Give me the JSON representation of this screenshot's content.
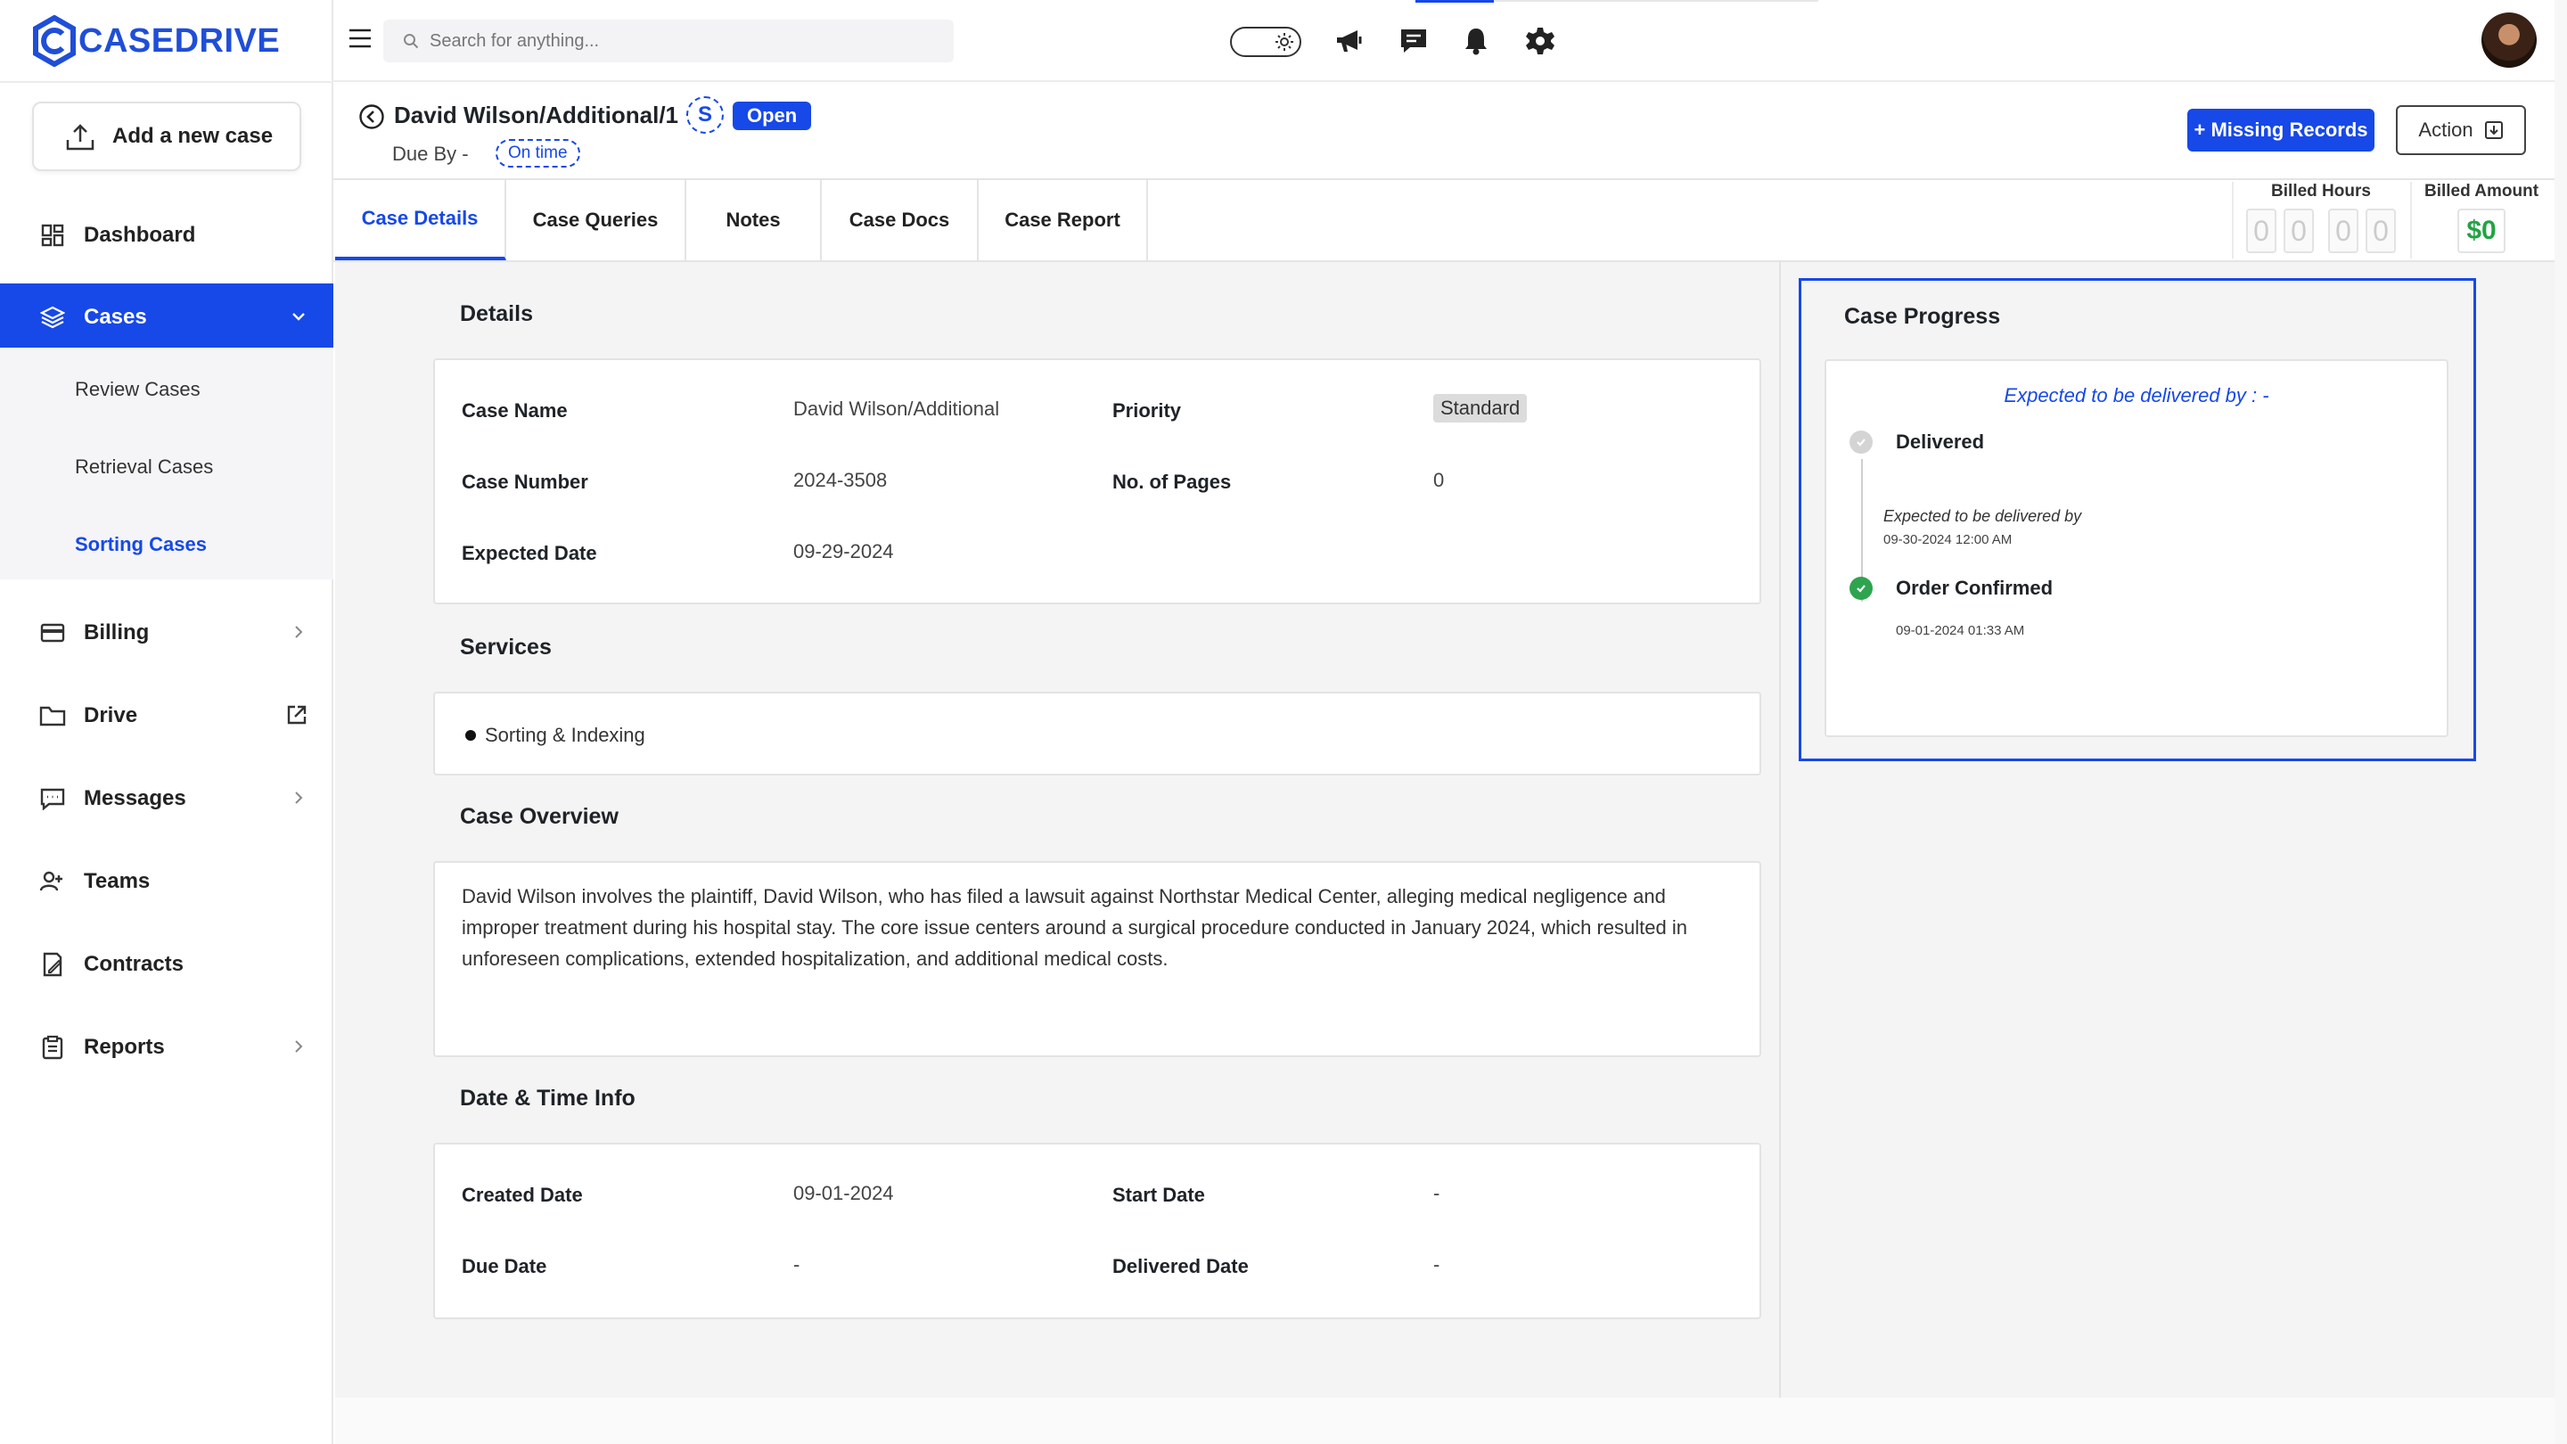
{
  "app": {
    "brand": "CASEDRIVE",
    "accent_color": "#1748e8"
  },
  "sidebar": {
    "add_case_label": "Add a new case",
    "items": [
      {
        "label": "Dashboard",
        "icon": "dashboard-icon"
      },
      {
        "label": "Cases",
        "icon": "layers-icon",
        "active": true,
        "expanded": true
      },
      {
        "label": "Billing",
        "icon": "credit-card-icon"
      },
      {
        "label": "Drive",
        "icon": "folder-icon"
      },
      {
        "label": "Messages",
        "icon": "message-icon"
      },
      {
        "label": "Teams",
        "icon": "users-icon"
      },
      {
        "label": "Contracts",
        "icon": "contract-icon"
      },
      {
        "label": "Reports",
        "icon": "clipboard-icon"
      }
    ],
    "sub_items": [
      {
        "label": "Review Cases"
      },
      {
        "label": "Retrieval Cases"
      },
      {
        "label": "Sorting Cases",
        "active": true
      }
    ]
  },
  "search": {
    "placeholder": "Search for anything..."
  },
  "case": {
    "title": "David Wilson/Additional/1",
    "assignee_initial": "S",
    "status": "Open",
    "due_by_label": "Due By -",
    "timeliness": "On time",
    "missing_records_label": "+ Missing Records",
    "action_label": "Action"
  },
  "tabs": [
    {
      "label": "Case Details",
      "active": true
    },
    {
      "label": "Case Queries"
    },
    {
      "label": "Notes"
    },
    {
      "label": "Case Docs"
    },
    {
      "label": "Case Report"
    }
  ],
  "billing": {
    "hours_label": "Billed Hours",
    "hours_digits": [
      "0",
      "0",
      "0",
      "0"
    ],
    "amount_label": "Billed Amount",
    "amount": "$0"
  },
  "details": {
    "title": "Details",
    "case_name_label": "Case Name",
    "case_name": "David  Wilson/Additional",
    "priority_label": "Priority",
    "priority": "Standard",
    "case_number_label": "Case Number",
    "case_number": "2024-3508",
    "pages_label": "No. of Pages",
    "pages": "0",
    "expected_date_label": "Expected Date",
    "expected_date": "09-29-2024"
  },
  "services": {
    "title": "Services",
    "items": [
      "Sorting & Indexing"
    ]
  },
  "overview": {
    "title": "Case Overview",
    "text": "David Wilson involves the plaintiff, David Wilson, who has filed a lawsuit against Northstar Medical Center, alleging medical negligence and improper treatment during his hospital stay. The core issue centers around a surgical procedure conducted in January 2024, which resulted in unforeseen complications, extended hospitalization, and additional medical costs."
  },
  "datetime": {
    "title": "Date & Time Info",
    "created_label": "Created Date",
    "created": "09-01-2024",
    "start_label": "Start Date",
    "start": "-",
    "due_label": "Due Date",
    "due": "-",
    "delivered_label": "Delivered Date",
    "delivered": "-"
  },
  "progress": {
    "title": "Case Progress",
    "expected_header": "Expected to be delivered by : -",
    "steps": [
      {
        "label": "Delivered",
        "status": "pending",
        "note": "Expected to be delivered by",
        "time": "09-30-2024 12:00 AM"
      },
      {
        "label": "Order Confirmed",
        "status": "done",
        "time": "09-01-2024 01:33 AM"
      }
    ],
    "done_color": "#2ea44f",
    "pending_color": "#cfcfcf"
  }
}
